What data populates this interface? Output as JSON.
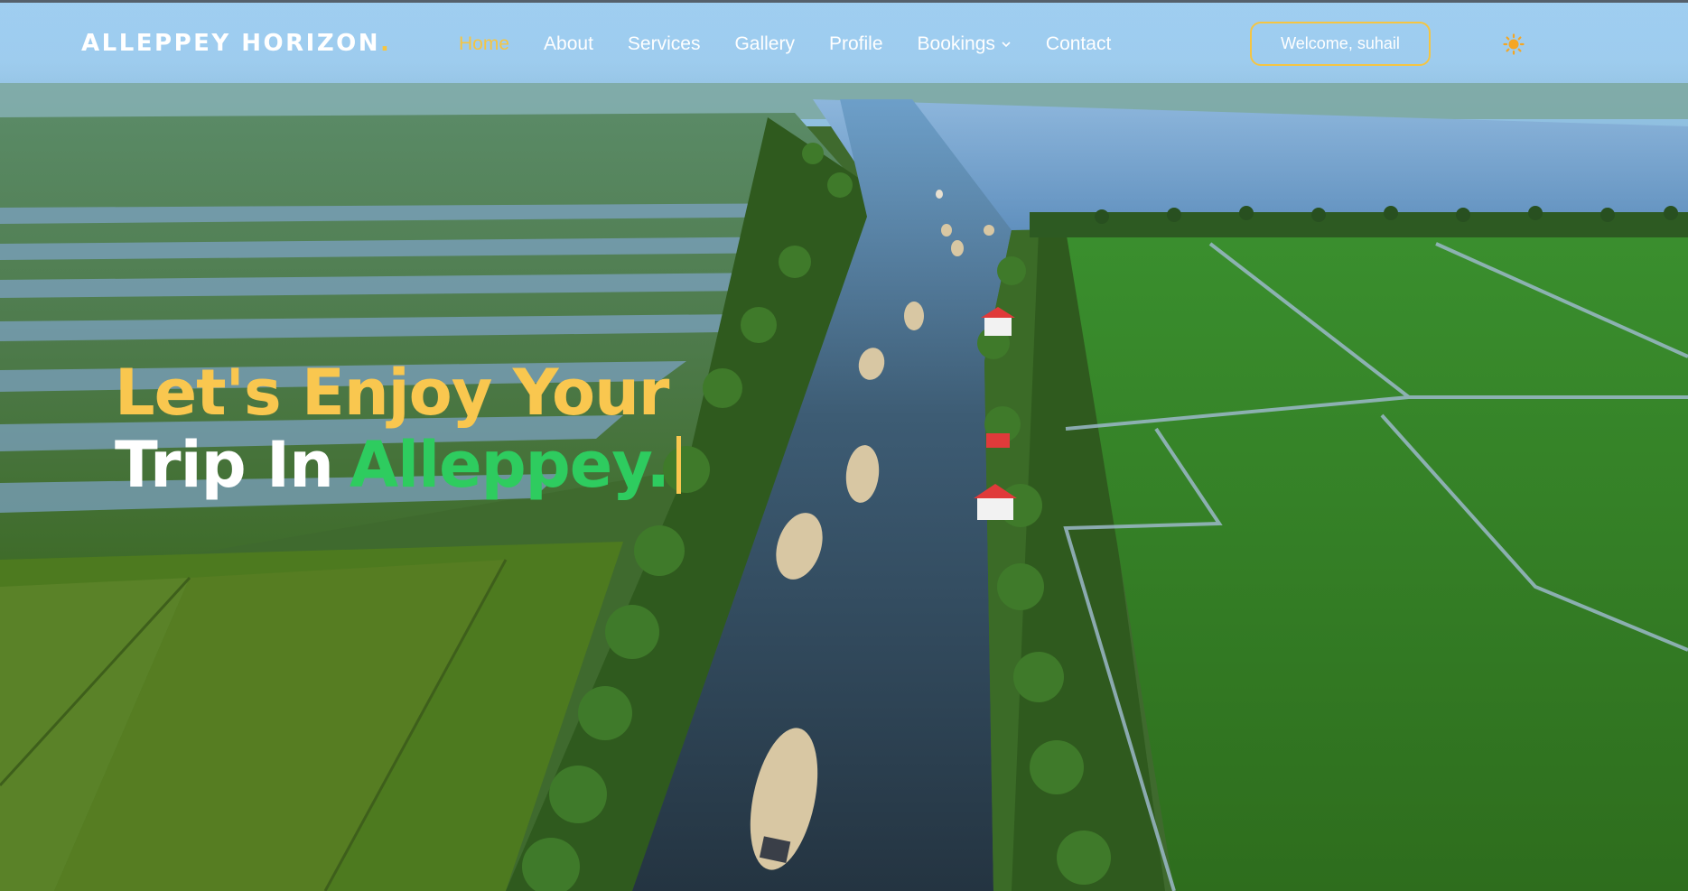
{
  "brand": {
    "name": "ALLEPPEY HORIZON",
    "dot": "."
  },
  "nav": {
    "items": [
      {
        "label": "Home",
        "active": true
      },
      {
        "label": "About"
      },
      {
        "label": "Services"
      },
      {
        "label": "Gallery"
      },
      {
        "label": "Profile"
      },
      {
        "label": "Bookings",
        "has_dropdown": true
      },
      {
        "label": "Contact"
      }
    ],
    "welcome_label": "Welcome, suhail",
    "theme_icon": "sun-icon"
  },
  "hero": {
    "line1": "Let's Enjoy Your",
    "line2_white": "Trip In",
    "line2_green": "Alleppey."
  },
  "colors": {
    "accent": "#f5c542",
    "headline_yellow": "#f9c74f",
    "headline_green": "#2ecc5f",
    "nav_bg": "#9ecdf0"
  }
}
